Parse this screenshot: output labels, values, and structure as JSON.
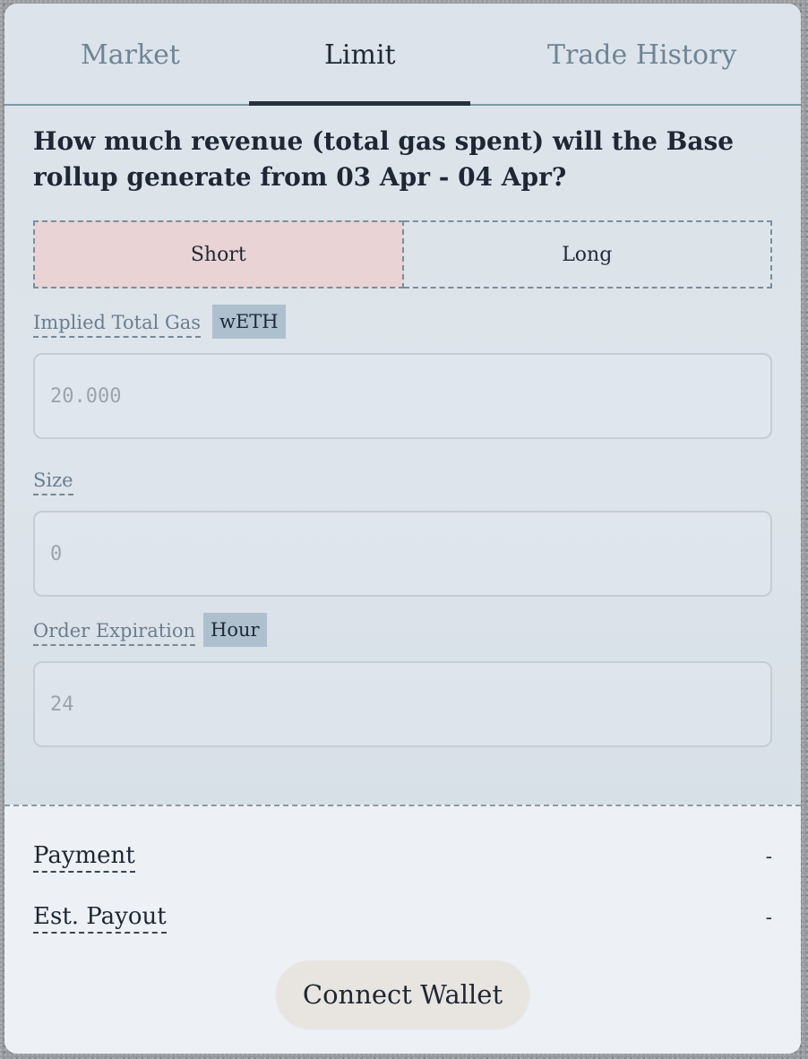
{
  "tabs": {
    "market": "Market",
    "limit": "Limit",
    "trade_history": "Trade History",
    "active": "Limit"
  },
  "question": "How much revenue (total gas spent) will the Base rollup generate from 03 Apr - 04 Apr?",
  "position_toggle": {
    "short_label": "Short",
    "long_label": "Long",
    "selected": "Short"
  },
  "fields": {
    "implied_total_gas": {
      "label": "Implied Total Gas",
      "unit": "wETH",
      "placeholder": "20.000"
    },
    "size": {
      "label": "Size",
      "placeholder": "0"
    },
    "order_expiration": {
      "label": "Order Expiration",
      "unit": "Hour",
      "placeholder": "24"
    }
  },
  "summary": {
    "payment_label": "Payment",
    "payment_value": "-",
    "est_payout_label": "Est. Payout",
    "est_payout_value": "-"
  },
  "connect_wallet_label": "Connect Wallet",
  "colors": {
    "short_selected_bg": "#e9d3d4",
    "badge_bg": "#aec0cd",
    "active_tab_underline": "#26313d"
  }
}
